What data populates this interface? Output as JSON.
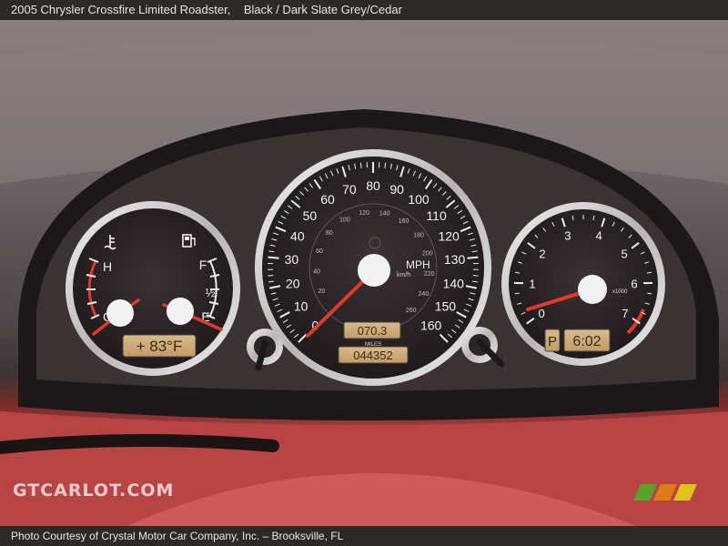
{
  "caption": {
    "title": "2005 Chrysler Crossfire Limited Roadster,",
    "subtitle": "Black / Dark Slate Grey/Cedar"
  },
  "footer": {
    "credit": "Photo Courtesy of Crystal Motor Car Company, Inc. – Brooksville, FL"
  },
  "watermark": {
    "text": "GTCARLOT.COM"
  },
  "brand_colors": {
    "stripe_green": "#5aa32a",
    "stripe_orange": "#e07a1a",
    "stripe_yellow": "#e0c21a",
    "needle": "#e03a2e",
    "upholstery": "#c04a4a"
  },
  "cluster": {
    "speedometer": {
      "unit_label": "MPH",
      "unit_label_secondary": "km/h",
      "mph_ticks": [
        "0",
        "10",
        "20",
        "30",
        "40",
        "50",
        "60",
        "70",
        "80",
        "90",
        "100",
        "110",
        "120",
        "130",
        "140",
        "150",
        "160"
      ],
      "kmh_ticks": [
        "20",
        "40",
        "60",
        "80",
        "100",
        "120",
        "140",
        "160",
        "180",
        "200",
        "220",
        "240",
        "260"
      ],
      "trip_display": "070.3",
      "odometer_label": "MILES",
      "odometer_display": "044352",
      "needle_mph": 0
    },
    "left_gauge": {
      "temp_hot_label": "H",
      "temp_cold_label": "C",
      "fuel_full_label": "F",
      "fuel_half_label": "½",
      "fuel_empty_label": "E",
      "temperature_display": "+ 83°F",
      "temp_icon": "coolant-temp-icon",
      "fuel_icon": "fuel-pump-icon"
    },
    "tachometer": {
      "ticks": [
        "0",
        "1",
        "2",
        "3",
        "4",
        "5",
        "6",
        "7"
      ],
      "unit_label": "x1000",
      "gear_display": "P",
      "clock_display": "6:02",
      "needle_rpm": 0.6
    }
  }
}
